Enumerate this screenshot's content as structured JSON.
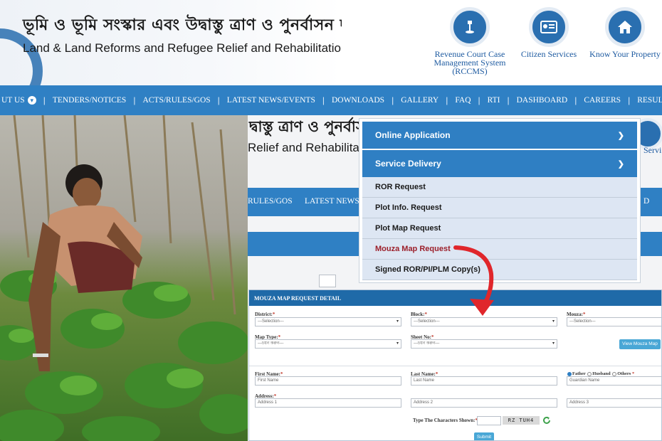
{
  "header": {
    "title_bengali": "ভূমি ও ভূমি সংস্কার এবং উদ্বাস্তু ত্রাণ ও পুনর্বাসন দপ্তর",
    "title_english": "Land & Land Reforms and Refugee Relief and Rehabilitation Department",
    "quick_links": [
      {
        "label": "Revenue Court Case Management System (RCCMS)",
        "icon": "gavel-icon"
      },
      {
        "label": "Citizen Services",
        "icon": "id-card-icon"
      },
      {
        "label": "Know Your Property",
        "icon": "home-icon"
      }
    ]
  },
  "nav": {
    "items": [
      "UT US",
      "TENDERS/NOTICES",
      "ACTS/RULES/GOS",
      "LATEST NEWS/EVENTS",
      "DOWNLOADS",
      "GALLERY",
      "FAQ",
      "RTI",
      "DASHBOARD",
      "CAREERS",
      "RESULT"
    ]
  },
  "background_page": {
    "title_bengali_fragment": "দ্বাস্তু ত্রাণ ও পুনর্বাসন",
    "title_english_fragment": "Relief and Rehabilitation D",
    "nav_fragments": [
      "RULES/GOS",
      "LATEST NEWS",
      "D"
    ],
    "service_fragment": "Servi"
  },
  "menu": {
    "headers": [
      {
        "label": "Online Application",
        "chevron": "chevron-down-icon"
      },
      {
        "label": "Service Delivery",
        "chevron": "chevron-down-icon"
      }
    ],
    "items": [
      "ROR Request",
      "Plot Info. Request",
      "Plot Map Request",
      "Mouza Map Request",
      "Signed ROR/PI/PLM Copy(s)"
    ],
    "active_item": "Mouza Map Request"
  },
  "form": {
    "title": "MOUZA MAP REQUEST DETAIL",
    "district_label": "District:",
    "district_value": "---Selection---",
    "block_label": "Block:",
    "block_value": "---Selection---",
    "mouza_label": "Mouza:",
    "mouza_value": "---Selection---",
    "map_type_label": "Map Type:",
    "map_type_value": "---চয়ন করুন---",
    "sheet_no_label": "Sheet No:",
    "sheet_no_value": "---চয়ন করুন---",
    "view_button": "View Mouza Map",
    "first_name_label": "First Name:",
    "first_name_placeholder": "First Name",
    "last_name_label": "Last Name:",
    "last_name_placeholder": "Last Name",
    "relation_options": [
      "Father",
      "Husband",
      "Others"
    ],
    "guardian_placeholder": "Guardian Name",
    "address_label": "Address:",
    "address1_placeholder": "Address 1",
    "address2_placeholder": "Address 2",
    "address3_placeholder": "Address 3",
    "captcha_label": "Type The Characters Shown:",
    "captcha_text": "RZ TUH4",
    "submit_label": "Submit",
    "required_mark": "*"
  },
  "colors": {
    "nav_blue": "#2f80c4",
    "menu_header_blue": "#2f7fc3",
    "submenu_bg": "#dde6f3",
    "active_item": "#9c1f2a",
    "arrow_red": "#e0262b"
  }
}
